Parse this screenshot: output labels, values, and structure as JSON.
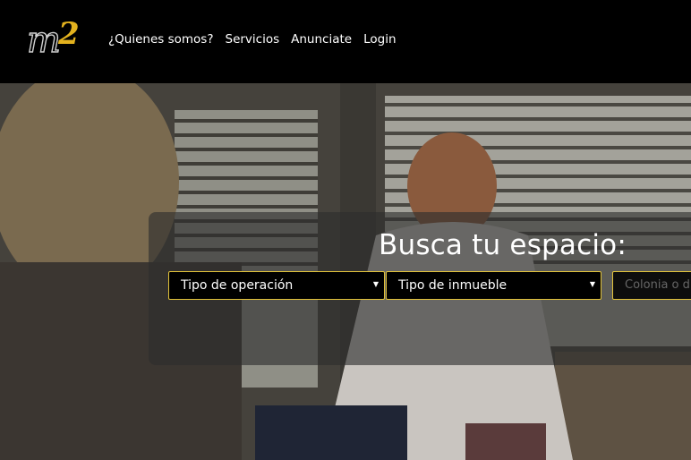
{
  "header": {
    "logo_text": "m2",
    "nav": [
      {
        "label": "¿Quienes somos?"
      },
      {
        "label": "Servicios"
      },
      {
        "label": "Anunciate"
      },
      {
        "label": "Login"
      }
    ]
  },
  "search": {
    "title": "Busca tu espacio:",
    "operation_select": {
      "value": "Tipo de operación"
    },
    "property_select": {
      "value": "Tipo de inmueble"
    },
    "colonia_input": {
      "placeholder": "Colonia o d"
    }
  },
  "colors": {
    "accent": "#e3c33a",
    "header_bg": "#000000",
    "panel_bg": "rgba(45,45,45,0.62)"
  }
}
